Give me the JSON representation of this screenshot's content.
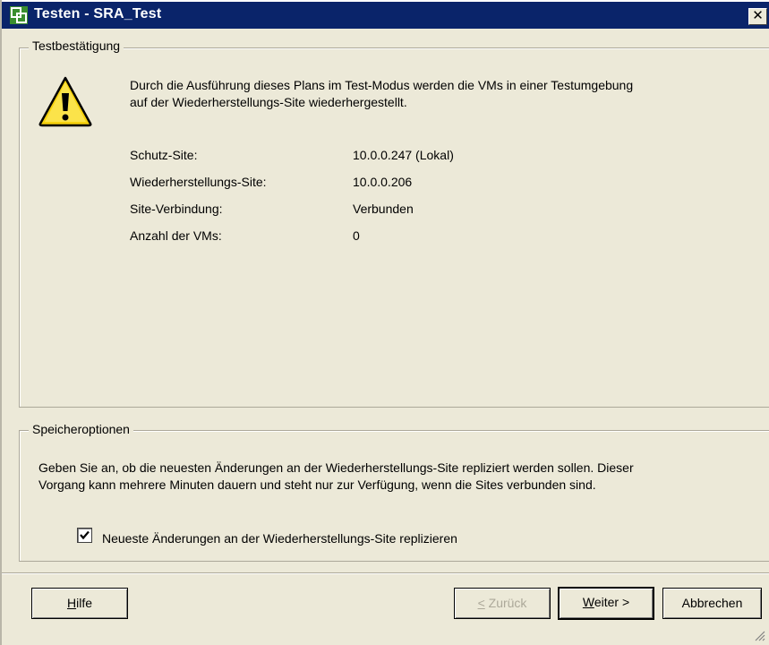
{
  "window": {
    "title": "Testen - SRA_Test",
    "close_label": "✕"
  },
  "confirmation": {
    "legend": "Testbestätigung",
    "description_line1": "Durch die Ausführung dieses Plans im Test-Modus werden die VMs in einer Testumgebung",
    "description_line2": "auf der Wiederherstellungs-Site wiederhergestellt.",
    "rows": [
      {
        "label": "Schutz-Site:",
        "value": "10.0.0.247 (Lokal)"
      },
      {
        "label": "Wiederherstellungs-Site:",
        "value": "10.0.0.206"
      },
      {
        "label": "Site-Verbindung:",
        "value": "Verbunden"
      },
      {
        "label": "Anzahl der VMs:",
        "value": "0"
      }
    ]
  },
  "storage": {
    "legend": "Speicheroptionen",
    "description_line1": "Geben Sie an, ob die neuesten Änderungen an der Wiederherstellungs-Site repliziert werden sollen. Dieser",
    "description_line2": "Vorgang kann mehrere Minuten dauern und steht nur zur Verfügung, wenn die Sites verbunden sind.",
    "checkbox_label": "Neueste Änderungen an der Wiederherstellungs-Site replizieren",
    "checkbox_checked": true
  },
  "buttons": {
    "help_underlined": "H",
    "help_rest": "ilfe",
    "back_prefix": "< ",
    "back_underlined": "<",
    "back_rest": " Zurück",
    "next_underlined": "W",
    "next_rest": "eiter >",
    "cancel": "Abbrechen"
  },
  "colors": {
    "titlebar": "#0a246a",
    "dialog_bg": "#ece9d8",
    "warning_yellow": "#f5d10d"
  }
}
